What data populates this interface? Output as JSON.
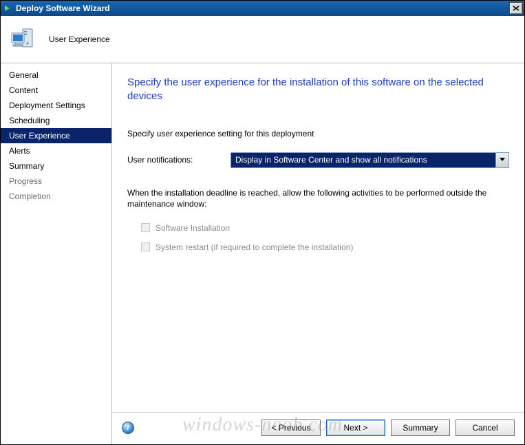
{
  "window": {
    "title": "Deploy Software Wizard"
  },
  "header": {
    "title": "User Experience"
  },
  "sidebar": {
    "items": [
      {
        "label": "General",
        "active": false
      },
      {
        "label": "Content",
        "active": false
      },
      {
        "label": "Deployment Settings",
        "active": false
      },
      {
        "label": "Scheduling",
        "active": false
      },
      {
        "label": "User Experience",
        "active": true
      },
      {
        "label": "Alerts",
        "active": false
      },
      {
        "label": "Summary",
        "active": false
      },
      {
        "label": "Progress",
        "active": false,
        "muted": true
      },
      {
        "label": "Completion",
        "active": false,
        "muted": true
      }
    ]
  },
  "content": {
    "heading": "Specify the user experience for the installation of this software on the selected devices",
    "intro": "Specify user experience setting for this deployment",
    "notifications_label": "User notifications:",
    "notifications_value": "Display in Software Center and show all notifications",
    "deadline_text": "When the installation deadline is reached, allow the following activities to be performed outside the maintenance window:",
    "checkboxes": [
      {
        "label": "Software Installation",
        "checked": false,
        "disabled": true
      },
      {
        "label": "System restart  (if required to complete the installation)",
        "checked": false,
        "disabled": true
      }
    ]
  },
  "footer": {
    "previous": "< Previous",
    "next": "Next >",
    "summary": "Summary",
    "cancel": "Cancel"
  },
  "watermark": "windows-noob.com"
}
